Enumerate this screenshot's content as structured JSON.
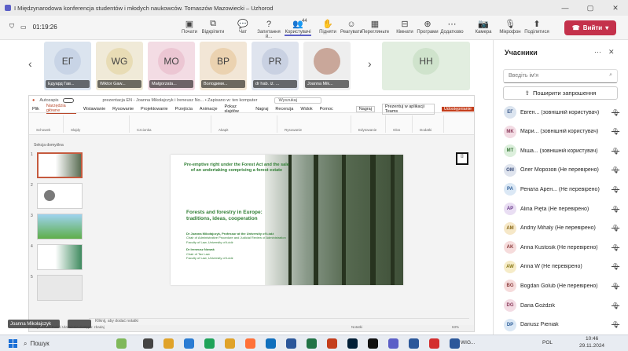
{
  "window": {
    "title": "I Międzynarodowa konferencja studentów i młodych naukowców. Tomaszów Mazowiecki – Uzhorod",
    "controls": [
      "—",
      "▢",
      "✕"
    ]
  },
  "meeting": {
    "timer": "01:19:26",
    "toolbar": [
      {
        "name": "pin",
        "label": "Почати",
        "icon": "▣"
      },
      {
        "name": "unpin",
        "label": "Відкріпити",
        "icon": "⧉"
      },
      {
        "name": "chat",
        "label": "Чат",
        "icon": "💬"
      },
      {
        "name": "qa",
        "label": "Запитання й...",
        "icon": "?"
      },
      {
        "name": "people",
        "label": "Користувачі",
        "icon": "👥",
        "count": "44",
        "active": true
      },
      {
        "name": "raise",
        "label": "Підняти",
        "icon": "✋"
      },
      {
        "name": "react",
        "label": "Реагувати",
        "icon": "☺"
      },
      {
        "name": "view",
        "label": "Перегляньте",
        "icon": "▦"
      },
      {
        "name": "rooms",
        "label": "Кімнати",
        "icon": "⊟"
      },
      {
        "name": "apps",
        "label": "Програми",
        "icon": "⊕"
      },
      {
        "name": "more",
        "label": "Додатково",
        "icon": "⋯"
      },
      {
        "name": "camera",
        "label": "Камера",
        "icon": "📷"
      },
      {
        "name": "mic",
        "label": "Мікрофон",
        "icon": "🎙"
      },
      {
        "name": "share",
        "label": "Поділитися",
        "icon": "⬆"
      }
    ],
    "leave_label": "Вийти"
  },
  "tiles": [
    {
      "initials": "ЕГ",
      "name": "Едуард Гав...",
      "bg": "#dbe4ef",
      "av": "#c8d4e6"
    },
    {
      "initials": "WG",
      "name": "Wiktor Gaw...",
      "bg": "#f0ead8",
      "av": "#e8dcb5"
    },
    {
      "initials": "MO",
      "name": "Małgorzata...",
      "bg": "#f3dce4",
      "av": "#ecc6d3"
    },
    {
      "initials": "ВР",
      "name": "Володими...",
      "bg": "#f2e6d6",
      "av": "#ebd2b0"
    },
    {
      "initials": "PR",
      "name": "dr hab. iż. ...",
      "bg": "#dfe4ee",
      "av": "#c9d1e2"
    },
    {
      "initials": "",
      "name": "Joanna Mik...",
      "bg": "#eeeeee",
      "av": "#c9a79a"
    },
    {
      "initials": "HH",
      "name": "",
      "bg": "#e2eee0",
      "av": "#cfe3cc"
    }
  ],
  "powerpoint": {
    "filename": "prezentacja EN - Joanna Mikołajczyk i Ireneusz No... • Zapisano w: ten komputer",
    "search": "Wyszukaj",
    "autosave": "Autozapis",
    "tabs": [
      "Plik",
      "Narzędzia główne",
      "Wstawianie",
      "Rysowanie",
      "Projektowanie",
      "Przejścia",
      "Animacje",
      "Pokaz slajdów",
      "Nagraj",
      "Recenzja",
      "Widok",
      "Pomoc"
    ],
    "ribbon_groups": [
      "Schowek",
      "Slajdy",
      "Czcionka",
      "Akapit",
      "Rysowanie",
      "Edytowanie",
      "Głos",
      "Dodatki"
    ],
    "record_label": "Nagraj",
    "present_teams": "Prezentuj w aplikacji Teams",
    "share_btn": "Udostępnianie",
    "section": "Sekcja domyślna",
    "slide_nums": [
      "1",
      "2",
      "3",
      "4",
      "5"
    ],
    "slide": {
      "title": "Pre-emptive right under the Forest Act and the sale of an undertaking comprising a forest estate",
      "subtitle": "Forests and forestry in Europe: traditions, ideas, cooperation",
      "author1": "Dr Joanna Mikołajczyk, Professor at the University of Łódź",
      "affil1": "Chair of Administrative Procedure and Judicial Review of Administration",
      "faculty1": "Faculty of Law, University of Łódź",
      "author2": "Dr Ireneusz Nowak",
      "affil2": "Chair of Tax Law",
      "faculty2": "Faculty of Law, University of Łódź"
    },
    "notes_placeholder": "Kliknij, aby dodać notatki",
    "status": "Slajd 1 z 14   Polski   Ułatwienia dostępu: zbadaj",
    "zoom": "63%",
    "notes_btn": "Notatki"
  },
  "self_view": {
    "name": "Joanna Mikołajczyk"
  },
  "participants": {
    "title": "Учасники",
    "search_placeholder": "Введіть ім'я",
    "share_invite": "Поширити запрошення",
    "list": [
      {
        "initials": "ЕГ",
        "name": "Евген... (зовнішній користувач)",
        "bg": "#dbe4ef",
        "fg": "#3b5a8a"
      },
      {
        "initials": "MK",
        "name": "Мари... (зовнішній користувач)",
        "bg": "#f3dce4",
        "fg": "#8a3b5a"
      },
      {
        "initials": "MT",
        "name": "Міша... (зовнішній користувач)",
        "bg": "#dcefdc",
        "fg": "#3b7a3b"
      },
      {
        "initials": "OM",
        "name": "Олег Морозов (Не перевірено)",
        "bg": "#dfe4ee",
        "fg": "#3b4e7a"
      },
      {
        "initials": "PA",
        "name": "Рената Арен... (Не перевірено)",
        "bg": "#dbe8f5",
        "fg": "#2f5f99"
      },
      {
        "initials": "AP",
        "name": "Alina Pięta (Не перевірено)",
        "bg": "#e9def3",
        "fg": "#6a3b8a"
      },
      {
        "initials": "AM",
        "name": "Andriy Mihaly (Не перевірено)",
        "bg": "#f6e8c8",
        "fg": "#8a6a1a"
      },
      {
        "initials": "AK",
        "name": "Anna Kustosik (Не перевірено)",
        "bg": "#f6dcdc",
        "fg": "#8a3b3b"
      },
      {
        "initials": "AW",
        "name": "Anna W (Не перевірено)",
        "bg": "#f6ecc8",
        "fg": "#8a7a1a"
      },
      {
        "initials": "BG",
        "name": "Bogdan Golub (Не перевірено)",
        "bg": "#f6dcdc",
        "fg": "#8a3b3b"
      },
      {
        "initials": "DG",
        "name": "Daria Goździk",
        "bg": "#f3dce4",
        "fg": "#8a3b5a"
      },
      {
        "initials": "DP",
        "name": "Dariusz Pieniak",
        "bg": "#dbe8f5",
        "fg": "#2f5f99"
      }
    ]
  },
  "taskbar": {
    "search": "Пошук",
    "tray_lang": "POL",
    "time": "10:46",
    "date": "29.11.2024",
    "active_app": "WIG..."
  }
}
